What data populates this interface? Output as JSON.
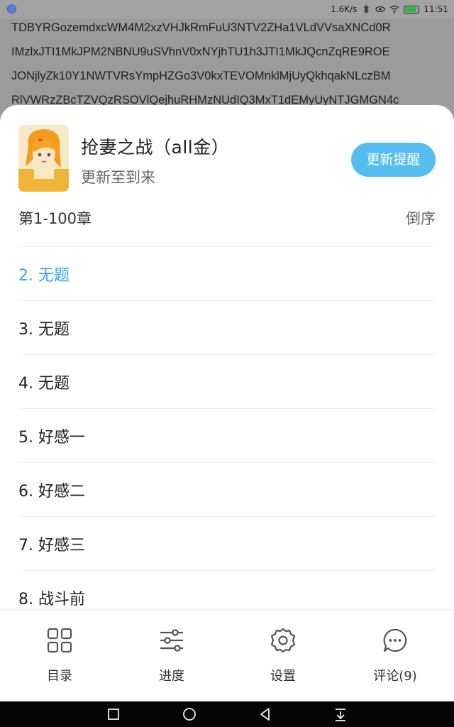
{
  "status_bar": {
    "net_speed": "1.6K/s",
    "time": "11:51",
    "icons": [
      "app-notification-icon",
      "bluetooth-icon",
      "eye-comfort-icon",
      "wifi-icon",
      "battery-icon"
    ],
    "battery_color": "#2fb84a"
  },
  "background_text": [
    "TDBYRGozemdxcWM4M2xzVHJkRmFuU3NTV2ZHa1VLdVVsaXNCd0R",
    "IMzlxJTI1MkJPM2NBNU9uSVhnV0xNYjhTU1h3JTI1MkJQcnZqRE9ROE",
    "JONjlyZk10Y1NWTVRsYmpHZGo3V0kxTEVOMnklMjUyQkhqakNLczBM",
    "RlVWRzZBcTZVQzRSOVlQejhuRHMzNUdIQ3MxT1dEMyUyNTJGMGN4c"
  ],
  "book": {
    "title": "抢妻之战（all金）",
    "subtitle": "更新至到来",
    "remind_button": "更新提醒"
  },
  "chapters_header": {
    "range": "第1-100章",
    "order": "倒序"
  },
  "chapters": [
    {
      "label": "2. 无题",
      "current": true
    },
    {
      "label": "3. 无题",
      "current": false
    },
    {
      "label": "4. 无题",
      "current": false
    },
    {
      "label": "5. 好感一",
      "current": false
    },
    {
      "label": "6. 好感二",
      "current": false
    },
    {
      "label": "7. 好感三",
      "current": false
    },
    {
      "label": "8. 战斗前",
      "current": false
    }
  ],
  "bottom_tabs": [
    {
      "label": "目录",
      "icon": "grid-icon"
    },
    {
      "label": "进度",
      "icon": "sliders-icon"
    },
    {
      "label": "设置",
      "icon": "gear-icon"
    },
    {
      "label": "评论(9)",
      "icon": "comment-icon"
    }
  ],
  "nav_bar": {
    "buttons": [
      "recents-square-icon",
      "home-circle-icon",
      "back-triangle-icon",
      "notification-pull-icon"
    ]
  },
  "colors": {
    "accent": "#56bdf1",
    "current_chapter": "#2fa7e8",
    "overlay": "#9b9b9b"
  }
}
